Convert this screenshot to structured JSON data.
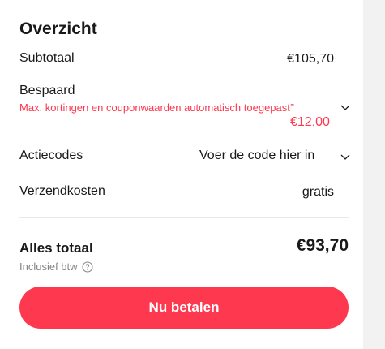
{
  "summary": {
    "title": "Overzicht",
    "subtotal": {
      "label": "Subtotaal",
      "value": "€105,70"
    },
    "savings": {
      "label": "Bespaard",
      "description": "Max. kortingen en couponwaarden automatisch toegepast",
      "value": "-\n€12,00"
    },
    "promo": {
      "label": "Actiecodes",
      "value": "Voer de code hier in"
    },
    "shipping": {
      "label": "Verzendkosten",
      "value": "gratis"
    },
    "total": {
      "label": "Alles totaal",
      "value": "€93,70",
      "vat_note": "Inclusief btw"
    },
    "pay_button": "Nu betalen"
  },
  "icons": {
    "savings_toggle": "chevron-down-icon",
    "promo_toggle": "chevron-down-icon",
    "vat_info": "info-icon"
  },
  "colors": {
    "accent": "#fd384f",
    "text": "#191919",
    "muted": "#858585"
  }
}
